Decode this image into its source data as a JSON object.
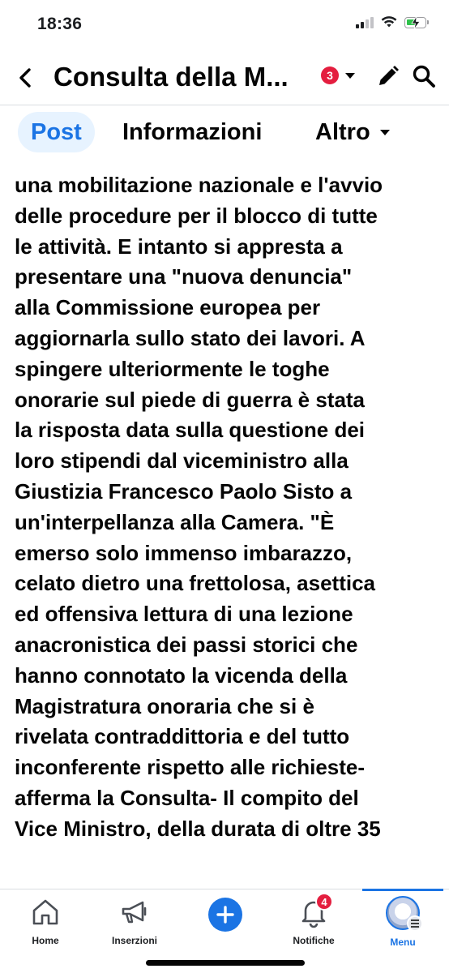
{
  "status_bar": {
    "time": "18:36"
  },
  "header": {
    "title": "Consulta della M...",
    "badge_count": "3",
    "icons": [
      "back-chevron-icon",
      "caret-down-icon",
      "pencil-icon",
      "search-icon"
    ]
  },
  "tabs": [
    {
      "label": "Post",
      "active": true
    },
    {
      "label": "Informazioni",
      "active": false
    },
    {
      "label": "Altro",
      "active": false
    }
  ],
  "article": {
    "lines": [
      "una mobilitazione nazionale e l'avvio",
      "delle procedure per il blocco di tutte",
      "le attività. E intanto si appresta a",
      "presentare una \"nuova denuncia\"",
      "alla Commissione europea per",
      "aggiornarla sullo stato dei lavori. A",
      "spingere ulteriormente le toghe",
      "onorarie sul piede di guerra è stata",
      "la risposta data sulla questione dei",
      "loro stipendi dal viceministro alla",
      "Giustizia Francesco Paolo Sisto a",
      "un'interpellanza alla Camera. \"È",
      "emerso solo immenso imbarazzo,",
      "celato dietro una frettolosa, asettica",
      "ed offensiva lettura di una lezione",
      "anacronistica dei passi storici che",
      "hanno connotato la vicenda della",
      "Magistratura onoraria che si è",
      "rivelata contraddittoria e del tutto",
      "inconferente rispetto alle richieste-",
      "afferma la Consulta- Il compito del",
      "Vice Ministro, della durata di oltre 35"
    ]
  },
  "bottom_nav": {
    "home": "Home",
    "ads": "Inserzioni",
    "notifications": "Notifiche",
    "notifications_badge": "4",
    "menu": "Menu",
    "active": "Menu"
  },
  "colors": {
    "accent": "#1b74e4",
    "active_tab_bg": "#e7f3ff",
    "badge_red": "#e41e3f",
    "text": "#050505"
  }
}
